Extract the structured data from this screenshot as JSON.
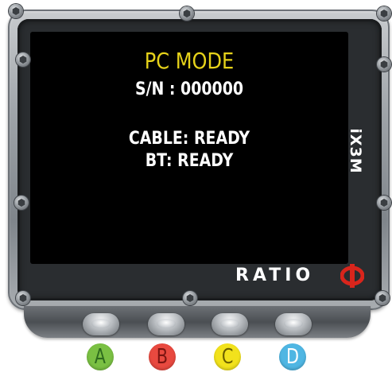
{
  "screen": {
    "mode_title": "PC MODE",
    "serial": "S/N : 000000",
    "cable_status": "CABLE: READY",
    "bt_status": "BT: READY"
  },
  "device": {
    "model": "iX3M",
    "brand": "RATIO",
    "brand_logo_icon": "phi-logo-icon"
  },
  "buttons": [
    {
      "label": "A",
      "color": "#7ac043",
      "text_color": "#2e6b1e"
    },
    {
      "label": "B",
      "color": "#e8493f",
      "text_color": "#7a1410"
    },
    {
      "label": "C",
      "color": "#f2e21c",
      "text_color": "#6b5f00"
    },
    {
      "label": "D",
      "color": "#4fb6e3",
      "text_color": "#ffffff"
    }
  ],
  "colors": {
    "title_yellow": "#e6d21a",
    "screen_bg": "#000000",
    "brand_red": "#d9251c"
  }
}
